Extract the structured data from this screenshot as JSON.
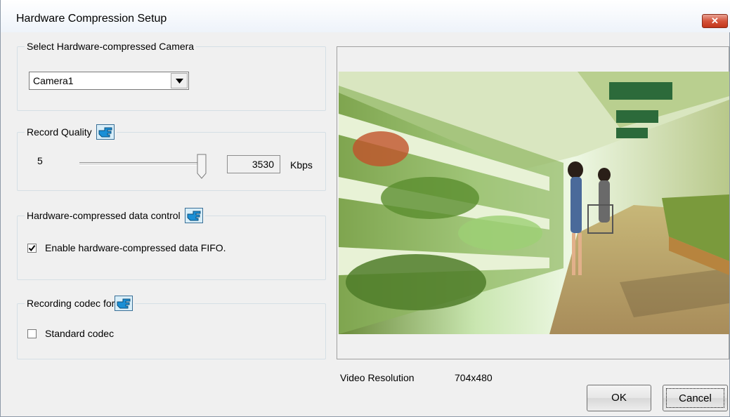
{
  "window": {
    "title": "Hardware Compression Setup",
    "close_label": "✕"
  },
  "camera_group": {
    "legend": "Select Hardware-compressed Camera",
    "selected": "Camera1"
  },
  "quality_group": {
    "legend": "Record Quality",
    "level": "5",
    "bitrate": "3530",
    "unit": "Kbps",
    "slider_fraction": 1.0
  },
  "data_control_group": {
    "legend": "Hardware-compressed data control",
    "fifo_label": "Enable hardware-compressed data FIFO.",
    "fifo_checked": true
  },
  "codec_group": {
    "legend": "Recording codec for",
    "standard_label": "Standard codec",
    "standard_checked": false
  },
  "preview": {
    "resolution_label": "Video Resolution",
    "resolution_value": "704x480"
  },
  "buttons": {
    "ok": "OK",
    "cancel": "Cancel"
  },
  "icons": {
    "help": "pointing-hand-icon",
    "dropdown": "chevron-down-icon",
    "close": "close-icon",
    "check": "check-icon"
  },
  "colors": {
    "title_bg": "#ffffff",
    "close_red": "#c8442a",
    "hand_blue": "#1a8fd6"
  }
}
